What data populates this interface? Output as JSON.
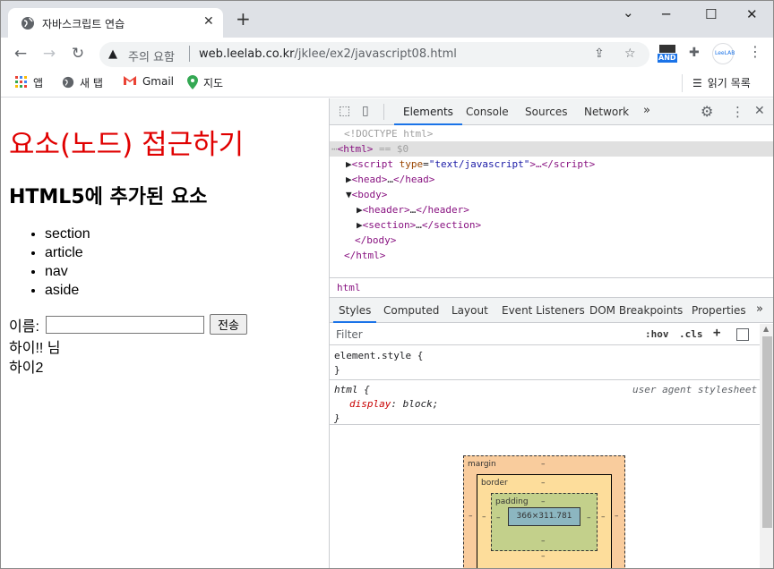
{
  "browser": {
    "tab_title": "자바스크립트 연습",
    "tab_close": "✕",
    "new_tab": "+",
    "window_controls": {
      "minimize": "─",
      "maximize": "☐",
      "close": "✕",
      "dropdown": "⌄"
    },
    "security_label": "주의 요함",
    "url_host": "web.leelab.co.kr",
    "url_path": "/jklee/ex2/javascript08.html",
    "ext_and_label": "AND",
    "ext_leelab_label": "LeeLAB",
    "bookmarks": [
      {
        "label": "앱",
        "icon": "apps-grid-icon"
      },
      {
        "label": "새 탭",
        "icon": "globe-icon"
      },
      {
        "label": "Gmail",
        "icon": "gmail-icon"
      },
      {
        "label": "지도",
        "icon": "maps-pin-icon"
      }
    ],
    "reading_list": "읽기 목록",
    "accent_color": "#1a73e8"
  },
  "page": {
    "h1": "요소(노드) 접근하기",
    "h1_color": "#e00000",
    "h2": "HTML5에 추가된 요소",
    "list": [
      "section",
      "article",
      "nav",
      "aside"
    ],
    "form_label": "이름:",
    "input_value": "",
    "submit_label": "전송",
    "output_lines": [
      "하이!! 님",
      "하이2"
    ]
  },
  "devtools": {
    "tabs": [
      "Elements",
      "Console",
      "Sources",
      "Network"
    ],
    "active_tab": "Elements",
    "more": "»",
    "dom": {
      "doctype": "<!DOCTYPE html>",
      "html_open": "<html>",
      "html_eq": " == $0",
      "script_tag": "script",
      "script_attr": "type",
      "script_val": "\"text/javascript\"",
      "script_ellipsis": ">…</",
      "head_open": "<head>",
      "head_close": "</head>",
      "body_open": "<body>",
      "header_open": "<header>",
      "header_close": "</header>",
      "section_open": "<section>",
      "section_close": "</section>",
      "body_close": "</body>",
      "html_close": "</html>",
      "ellipsis": "…"
    },
    "breadcrumb": "html",
    "style_tabs": [
      "Styles",
      "Computed",
      "Layout",
      "Event Listeners",
      "DOM Breakpoints",
      "Properties"
    ],
    "filter_placeholder": "Filter",
    "hov": ":hov",
    "cls": ".cls",
    "plus": "+",
    "rule1_selector": "element.style {",
    "rule1_close": "}",
    "rule2_selector": "html {",
    "rule2_source": "user agent stylesheet",
    "rule2_prop": "display",
    "rule2_val": "block;",
    "rule2_close": "}",
    "boxmodel": {
      "margin": "margin",
      "border": "border",
      "padding": "padding",
      "dash": "–",
      "content": "366×311.781"
    }
  }
}
